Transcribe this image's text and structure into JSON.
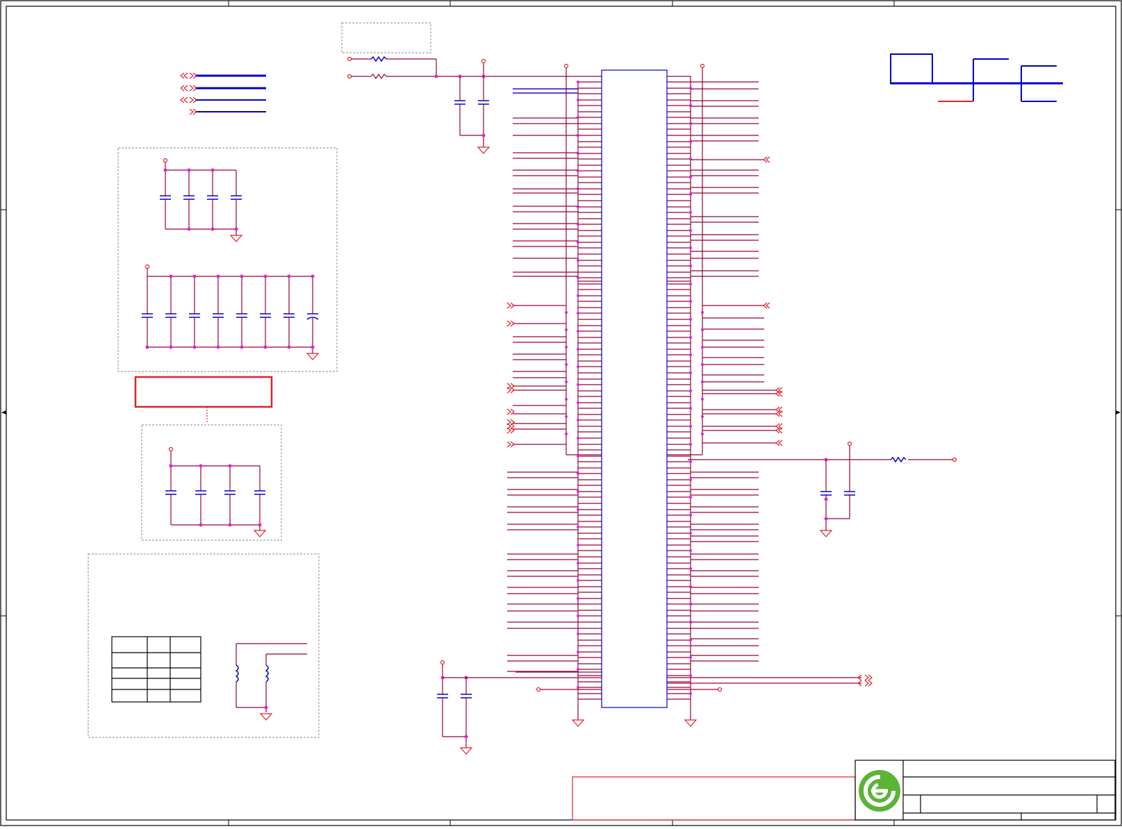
{
  "sheet": {
    "title_block": {
      "logo": "company-logo",
      "title": "",
      "doc_number": "",
      "revision": ""
    },
    "notes_box": "",
    "note_callout": ""
  },
  "colors": {
    "wire": "#990033",
    "net_red": "#e0202a",
    "component_blue": "#0000cc",
    "junction": "#e020e0",
    "logo_green": "#5bb435"
  }
}
